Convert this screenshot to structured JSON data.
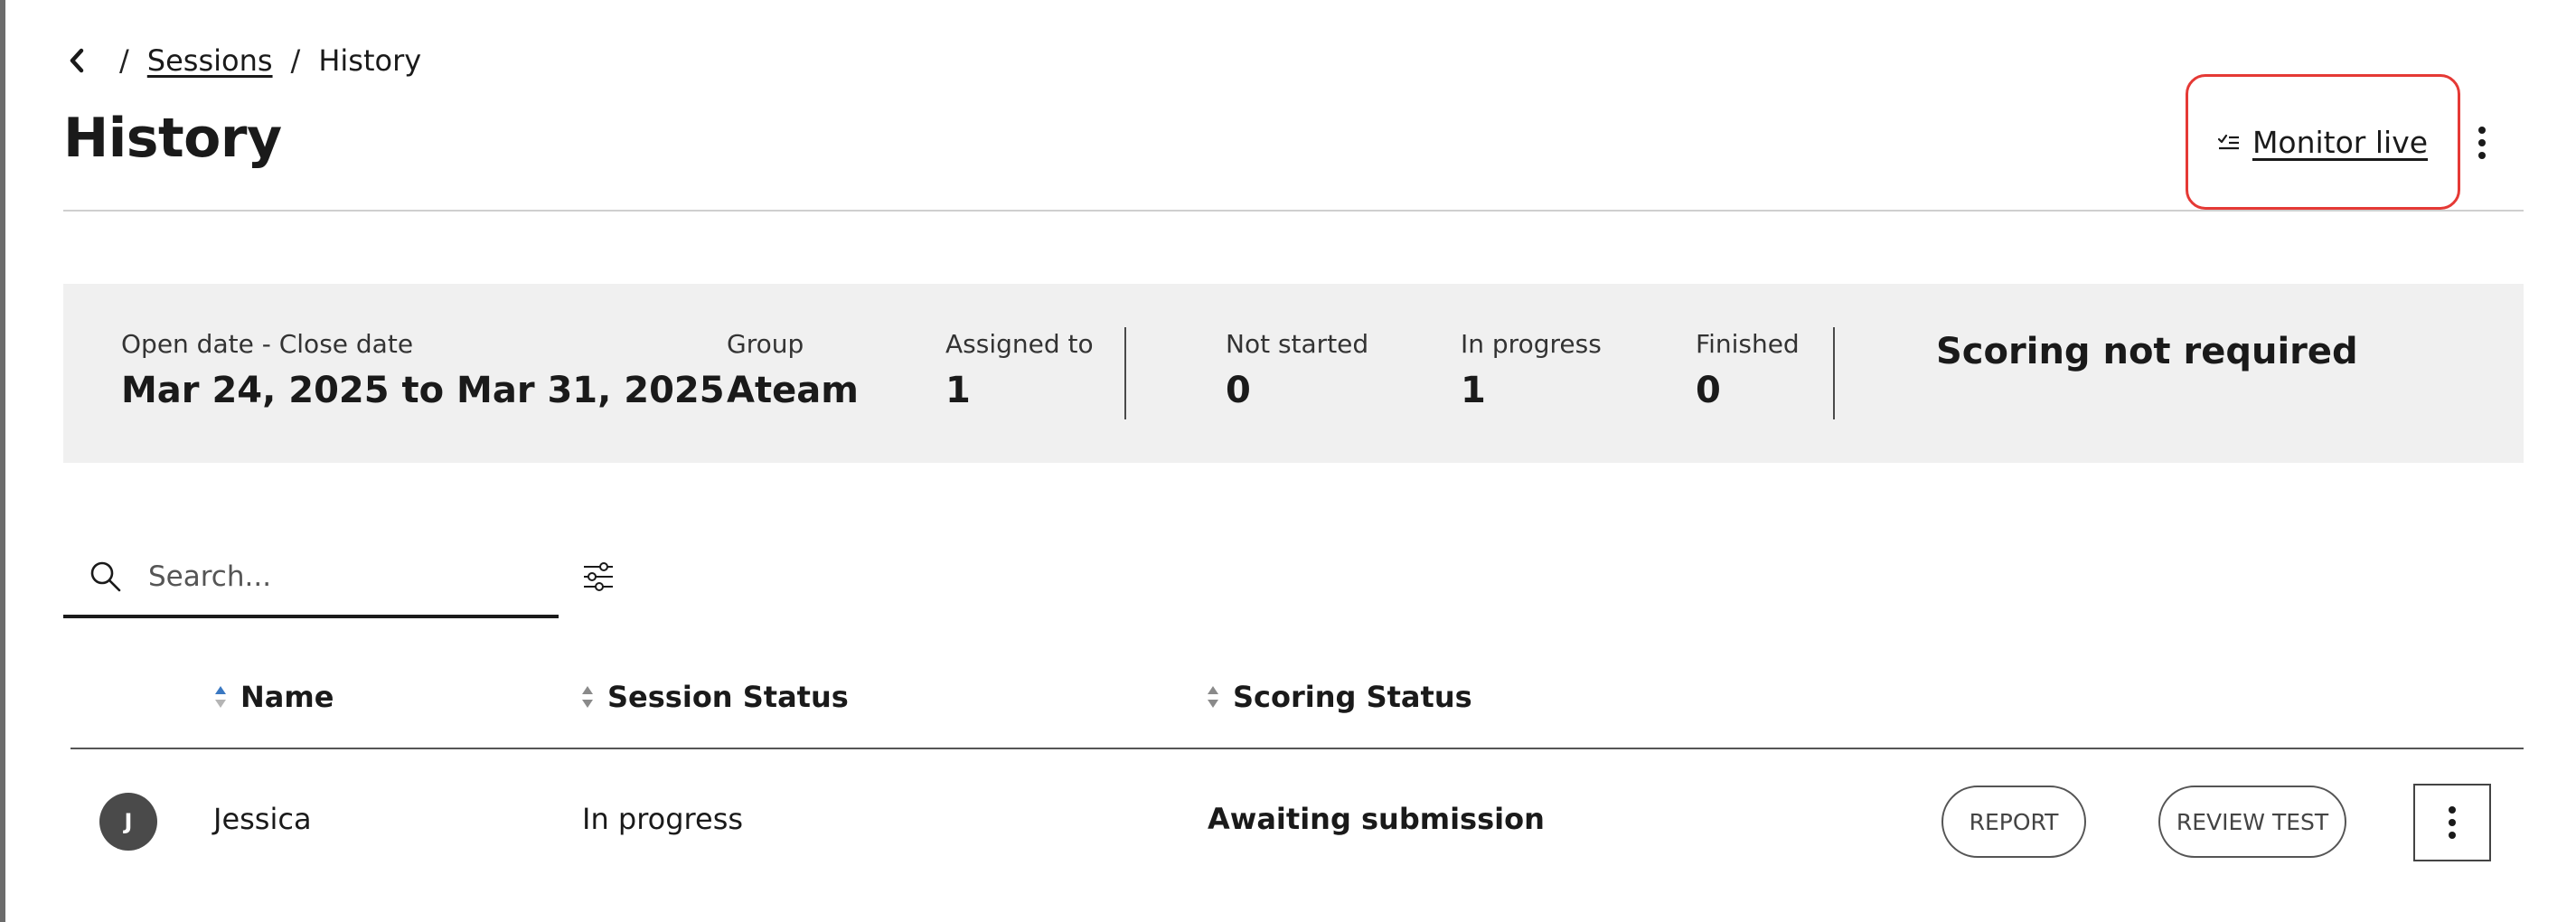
{
  "breadcrumb": {
    "items": [
      {
        "label": "Sessions",
        "link": true
      },
      {
        "label": "History",
        "link": false
      }
    ],
    "separator": "/"
  },
  "page": {
    "title": "History",
    "monitor_live_label": "Monitor live"
  },
  "summary": {
    "date": {
      "label": "Open date - Close date",
      "value": "Mar 24, 2025 to Mar 31, 2025"
    },
    "group": {
      "label": "Group",
      "value": "Ateam"
    },
    "assigned": {
      "label": "Assigned to",
      "value": "1"
    },
    "not_started": {
      "label": "Not started",
      "value": "0"
    },
    "in_progress": {
      "label": "In progress",
      "value": "1"
    },
    "finished": {
      "label": "Finished",
      "value": "0"
    },
    "scoring_note": "Scoring not required"
  },
  "search": {
    "placeholder": "Search..."
  },
  "table": {
    "columns": [
      {
        "label": "Name",
        "sort": "asc"
      },
      {
        "label": "Session Status",
        "sort": "none"
      },
      {
        "label": "Scoring Status",
        "sort": "none"
      }
    ],
    "rows": [
      {
        "avatar_initial": "J",
        "name": "Jessica",
        "session_status": "In progress",
        "scoring_status": "Awaiting submission",
        "report_label": "REPORT",
        "review_label": "REVIEW TEST"
      }
    ]
  },
  "colors": {
    "highlight_border": "#e53935",
    "sort_active": "#3a78c2",
    "sort_inactive": "#8a8a8a",
    "panel_bg": "#f0f0f0"
  },
  "icons": {
    "back": "chevron-left-icon",
    "monitor": "checklist-icon",
    "menu": "more-vertical-icon",
    "search": "search-icon",
    "filter": "filter-sliders-icon",
    "sort": "sort-arrows-icon"
  }
}
